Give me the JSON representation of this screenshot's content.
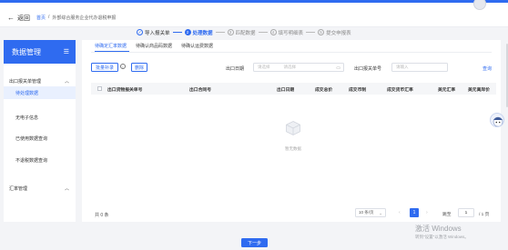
{
  "header": {
    "back_label": "返回",
    "breadcrumb": {
      "home": "首页",
      "separator": "/",
      "current": "外部综合服务企业代办退税申报"
    }
  },
  "steps": [
    {
      "num": "✓",
      "label": "导入报关单",
      "state": "done"
    },
    {
      "num": "2",
      "label": "处理数据",
      "state": "active"
    },
    {
      "num": "3",
      "label": "匹配数据",
      "state": "pending"
    },
    {
      "num": "4",
      "label": "填写明细表",
      "state": "pending"
    },
    {
      "num": "5",
      "label": "提交申报表",
      "state": "pending"
    }
  ],
  "sidebar": {
    "title": "数据管理",
    "groups": [
      {
        "label": "出口报关单管理",
        "items": [
          "待处理数据",
          "无电子信息",
          "已使用数据查询",
          "不退税数据查询"
        ]
      },
      {
        "label": "汇率管理"
      }
    ],
    "active_item": "待处理数据"
  },
  "tabs": [
    {
      "label": "待确定汇率数据",
      "active": true
    },
    {
      "label": "待确认商品码数据",
      "active": false
    },
    {
      "label": "待确认运费数据",
      "active": false
    }
  ],
  "toolbar": {
    "batch_fill_label": "批量补录",
    "delete_label": "删除",
    "export_date_label": "出口日期",
    "start_date_placeholder": "请选择",
    "end_date_placeholder": "请选择",
    "declaration_no_label": "出口报关单号",
    "declaration_no_placeholder": "请输入",
    "query_label": "查询"
  },
  "table": {
    "columns": [
      "出口货物报关单号",
      "出口合同号",
      "出口日期",
      "成交总价",
      "成交币制",
      "成交货币汇率",
      "美元汇率",
      "美元离岸价"
    ],
    "rows": [],
    "empty_text": "暂无数据"
  },
  "pagination": {
    "total_label": "共 0 条",
    "page_size": "10 条/页",
    "current_page": "1",
    "goto_label": "跳至",
    "goto_value": "1",
    "total_pages": "/ 1 页"
  },
  "footer": {
    "next_label": "下一步"
  },
  "watermark": {
    "title": "激活 Windows",
    "subtitle": "转到\"设置\"以激活 Windows。"
  },
  "colors": {
    "primary": "#2f6bf0",
    "active_bg": "#e9f0fe",
    "page_bg": "#f3f4f7"
  }
}
